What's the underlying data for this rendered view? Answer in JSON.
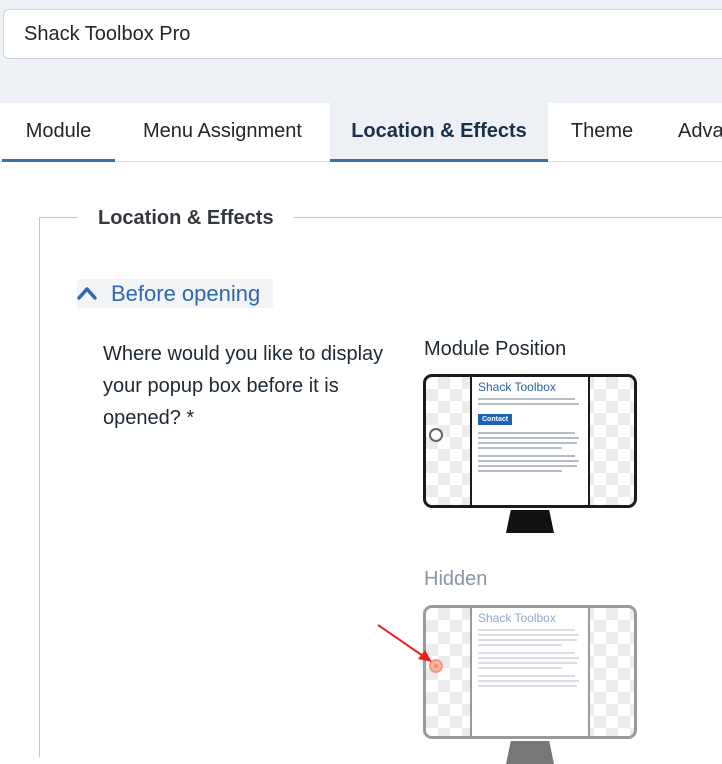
{
  "module_title": "Shack Toolbox Pro",
  "tabs": [
    {
      "label": "Module",
      "active": false
    },
    {
      "label": "Menu Assignment",
      "active": false
    },
    {
      "label": "Location & Effects",
      "active": true
    },
    {
      "label": "Theme",
      "active": false
    },
    {
      "label": "Adva",
      "active": false
    }
  ],
  "fieldset_legend": "Location & Effects",
  "section": {
    "toggle_label": "Before opening",
    "expanded": true
  },
  "question": "Where would you like to display your popup box before it is opened? *",
  "options": [
    {
      "label": "Module Position",
      "preview_title": "Shack Toolbox",
      "preview_button": "Contact",
      "selected": false
    },
    {
      "label": "Hidden",
      "preview_title": "Shack Toolbox",
      "selected": true
    }
  ],
  "colors": {
    "accent": "#2d68b1",
    "tab_underline": "#3c6fa8",
    "annotation_arrow": "#e8241c",
    "selected_radio": "#f6b8a6"
  }
}
